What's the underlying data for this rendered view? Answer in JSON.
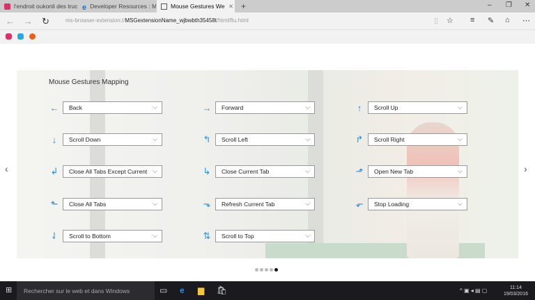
{
  "browser": {
    "tabs": [
      {
        "label": "l'endroit oukonli des trucs s",
        "active": false,
        "color": "#d6336c"
      },
      {
        "label": "Developer Resources : Micr",
        "active": false,
        "color": "#1a73c8"
      },
      {
        "label": "Mouse Gestures Welcor",
        "active": true,
        "color": "#555555"
      }
    ],
    "new_tab": "+",
    "close_tab": "✕",
    "url_prefix": "ms-browser-extension://",
    "url_host": "MSGextensionName_wjbwbth35458t",
    "url_path": "/html/ftu.html"
  },
  "page": {
    "title": "Mouse Gestures Mapping",
    "gestures": [
      {
        "arrow": "←",
        "action": "Back"
      },
      {
        "arrow": "→",
        "action": "Forward"
      },
      {
        "arrow": "↑",
        "action": "Scroll Up"
      },
      {
        "arrow": "↓",
        "action": "Scroll Down"
      },
      {
        "arrow": "↰",
        "action": "Scroll Left"
      },
      {
        "arrow": "↱",
        "action": "Scroll Right"
      },
      {
        "arrow": "↲",
        "action": "Close All Tabs Except Current"
      },
      {
        "arrow": "↳",
        "action": "Close Current Tab"
      },
      {
        "arrow": "⬏",
        "action": "Open New Tab"
      },
      {
        "arrow": "⬑",
        "action": "Close All Tabs"
      },
      {
        "arrow": "⬎",
        "action": "Refresh Current Tab"
      },
      {
        "arrow": "⬐",
        "action": "Stop Loading"
      },
      {
        "arrow": "⇃",
        "action": "Scroll to Bottom"
      },
      {
        "arrow": "⇅",
        "action": "Scroll to Top"
      }
    ],
    "slides": 5,
    "active_slide": 5
  },
  "taskbar": {
    "search_placeholder": "Rechercher sur le web et dans Windows",
    "time": "11:14",
    "date": "19/03/2016"
  }
}
